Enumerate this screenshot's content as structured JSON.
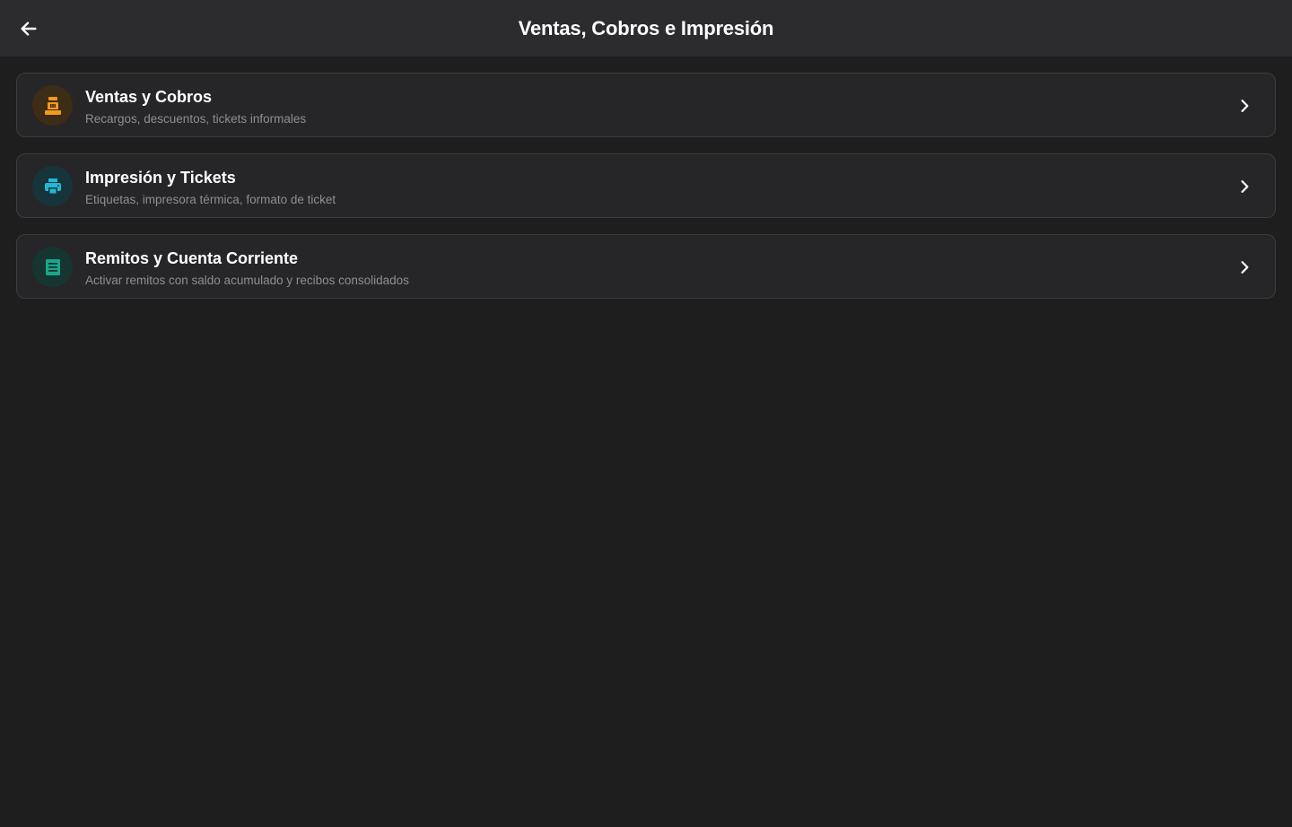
{
  "header": {
    "title": "Ventas, Cobros e Impresión",
    "back_icon": "arrow-left-icon"
  },
  "colors": {
    "background": "#1e1e1e",
    "topbar": "#2c2c2e",
    "card": "#262628",
    "card_border": "#3c3c3e",
    "orange": "#f59a1c",
    "cyan": "#22b8d6",
    "green": "#1aa68a"
  },
  "items": [
    {
      "title": "Ventas y Cobros",
      "subtitle": "Recargos, descuentos, tickets informales",
      "icon": "cash-register-icon",
      "color": "#f59a1c",
      "icon_bg": "#3d2c16"
    },
    {
      "title": "Impresión y Tickets",
      "subtitle": "Etiquetas, impresora térmica, formato de ticket",
      "icon": "printer-icon",
      "color": "#22b8d6",
      "icon_bg": "#17343b"
    },
    {
      "title": "Remitos y Cuenta Corriente",
      "subtitle": "Activar remitos con saldo acumulado y recibos consolidados",
      "icon": "receipt-icon",
      "color": "#1aa68a",
      "icon_bg": "#173530"
    }
  ]
}
